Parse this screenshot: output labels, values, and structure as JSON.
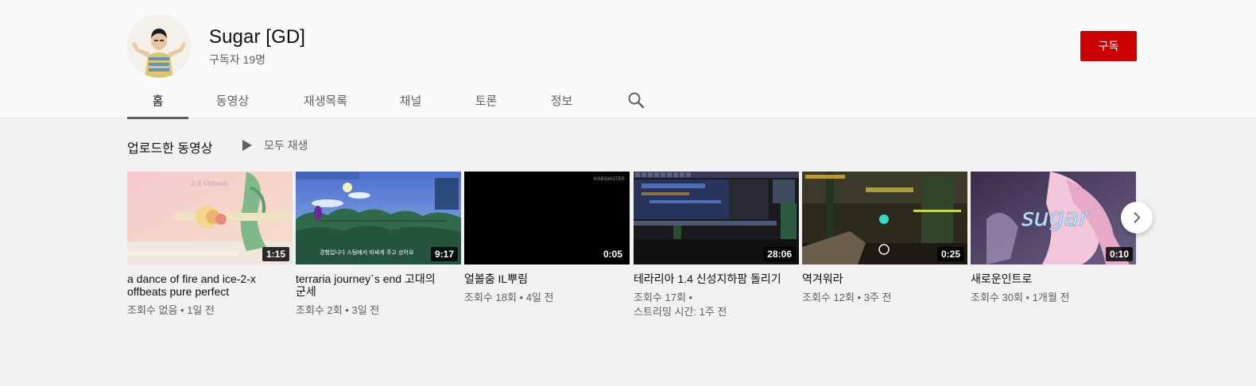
{
  "channel": {
    "title": "Sugar [GD]",
    "subscribers": "구독자 19명",
    "subscribe_label": "구독"
  },
  "tabs": [
    {
      "label": "홈",
      "active": true
    },
    {
      "label": "동영상"
    },
    {
      "label": "재생목록"
    },
    {
      "label": "채널"
    },
    {
      "label": "토론"
    },
    {
      "label": "정보"
    }
  ],
  "section": {
    "title": "업로드한 동영상",
    "play_all": "모두 재생"
  },
  "videos": [
    {
      "title": "a dance of fire and ice-2-x offbeats pure perfect",
      "duration": "1:15",
      "views": "조회수 없음",
      "time": "1일 전",
      "thumb_text": "2-X Offbeats"
    },
    {
      "title": "terraria journey`s end 고대의 군세",
      "duration": "9:17",
      "views": "조회수 2회",
      "time": "3일 전",
      "thumb_text": "경험입니다 스팀에서 비싸게 주고 샀어요"
    },
    {
      "title": "얼볼춤 IL뿌림",
      "duration": "0:05",
      "views": "조회수 18회",
      "time": "4일 전",
      "thumb_text": "KINEMASTER"
    },
    {
      "title": "테라리아 1.4 신성지하팜 돌리기",
      "duration": "28:06",
      "views": "조회수 17회",
      "time": "스트리밍 시간: 1주 전"
    },
    {
      "title": "역겨워라",
      "duration": "0:25",
      "views": "조회수 12회",
      "time": "3주 전"
    },
    {
      "title": "새로운인트로",
      "duration": "0:10",
      "views": "조회수 30회",
      "time": "1개월 전",
      "thumb_text": "sugar"
    }
  ],
  "colors": {
    "subscribe": "#cc0000",
    "header_bg": "#f9f9f9",
    "page_bg": "#f1f1f1"
  },
  "icons": {
    "search": "search-icon",
    "play": "play-icon",
    "next": "chevron-right-icon"
  }
}
